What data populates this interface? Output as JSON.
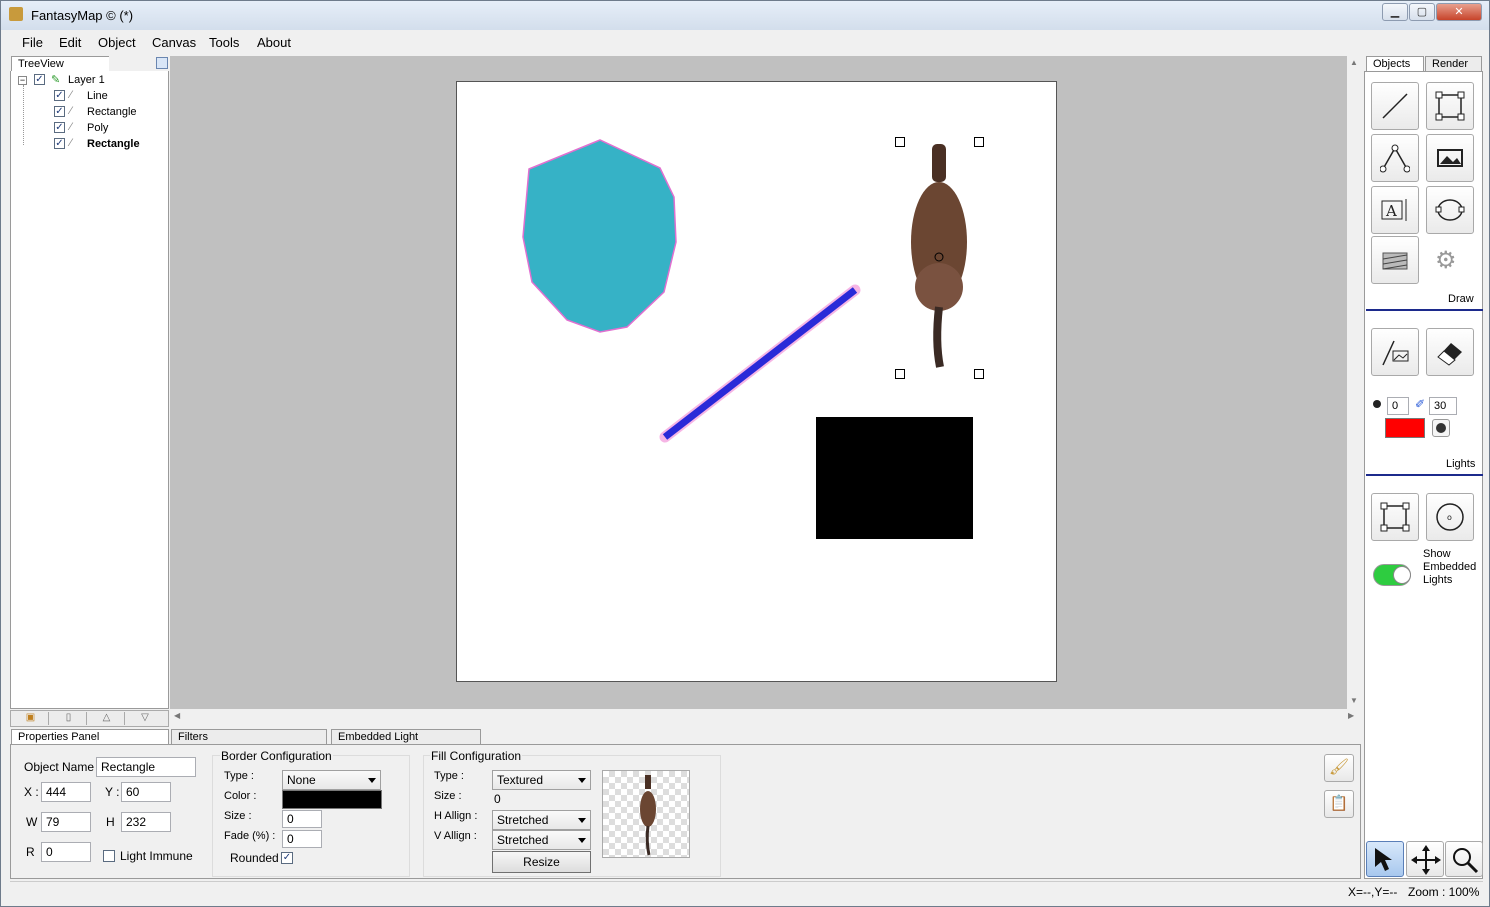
{
  "window": {
    "title": "FantasyMap © (*)",
    "min_label": "▁",
    "max_label": "▢",
    "close_label": "✕"
  },
  "menu": {
    "items": [
      "File",
      "Edit",
      "Object",
      "Canvas",
      "Tools",
      "About"
    ]
  },
  "treeview": {
    "tab_label": "TreeView",
    "layer": "Layer 1",
    "items": [
      "Line",
      "Rectangle",
      "Poly",
      "Rectangle"
    ]
  },
  "right_tabs": {
    "objects": "Objects",
    "render": "Render"
  },
  "sections": {
    "draw": "Draw",
    "lights": "Lights"
  },
  "brush": {
    "size": "0",
    "opacity": "30",
    "color": "#ff0000"
  },
  "lights": {
    "show_embedded": "Show Embedded Lights",
    "toggle_on": true
  },
  "bottom_tabs": {
    "properties": "Properties Panel",
    "filters": "Filters",
    "embedded_light": "Embedded Light"
  },
  "properties": {
    "object_name_label": "Object Name",
    "object_name": "Rectangle",
    "x_label": "X :",
    "x": "444",
    "y_label": "Y :",
    "y": "60",
    "w_label": "W",
    "w": "79",
    "h_label": "H",
    "h": "232",
    "r_label": "R",
    "r": "0",
    "light_immune_label": "Light Immune",
    "light_immune": false
  },
  "border": {
    "title": "Border Configuration",
    "type_label": "Type :",
    "type": "None",
    "color_label": "Color :",
    "color": "#000000",
    "size_label": "Size :",
    "size": "0",
    "fade_label": "Fade (%) :",
    "fade": "0",
    "rounded_label": "Rounded",
    "rounded": true
  },
  "fill": {
    "title": "Fill Configuration",
    "type_label": "Type :",
    "type": "Textured",
    "size_label": "Size :",
    "size": "0",
    "halign_label": "H Allign :",
    "halign": "Stretched",
    "valign_label": "V Allign :",
    "valign": "Stretched",
    "resize_label": "Resize"
  },
  "canvas_colors": {
    "poly": "#36b2c6",
    "line": "#2a2ad8",
    "line_glow": "#f07ad0",
    "rect": "#000000"
  },
  "status": {
    "coords": "X=--,Y=--",
    "zoom": "Zoom : 100%"
  },
  "icons": [
    "line-tool-icon",
    "rectangle-tool-icon",
    "poly-tool-icon",
    "image-tool-icon",
    "text-tool-icon",
    "ellipse-tool-icon",
    "hatch-tool-icon",
    "gear-icon",
    "brush-draw-icon",
    "eraser-icon",
    "light-rect-icon",
    "light-circle-icon",
    "select-arrow-icon",
    "move-icon",
    "zoom-icon",
    "paint-brush-icon",
    "paste-icon"
  ]
}
